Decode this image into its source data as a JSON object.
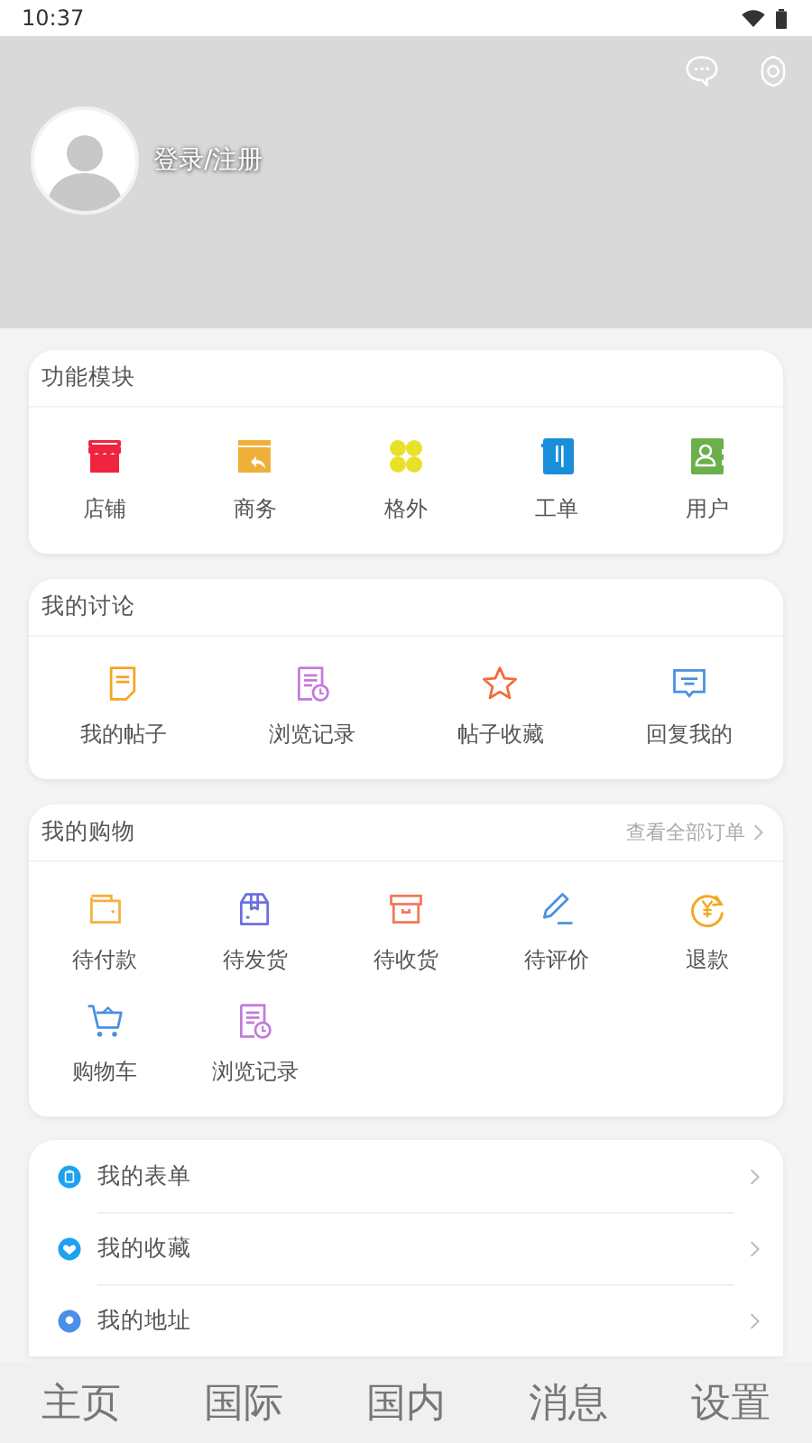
{
  "status_bar": {
    "time": "10:37"
  },
  "profile": {
    "login_label": "登录/注册"
  },
  "modules": {
    "title": "功能模块",
    "items": [
      {
        "label": "店铺"
      },
      {
        "label": "商务"
      },
      {
        "label": "格外"
      },
      {
        "label": "工单"
      },
      {
        "label": "用户"
      }
    ]
  },
  "discussion": {
    "title": "我的讨论",
    "items": [
      {
        "label": "我的帖子"
      },
      {
        "label": "浏览记录"
      },
      {
        "label": "帖子收藏"
      },
      {
        "label": "回复我的"
      }
    ]
  },
  "shopping": {
    "title": "我的购物",
    "link": "查看全部订单",
    "items": [
      {
        "label": "待付款"
      },
      {
        "label": "待发货"
      },
      {
        "label": "待收货"
      },
      {
        "label": "待评价"
      },
      {
        "label": "退款"
      },
      {
        "label": "购物车"
      },
      {
        "label": "浏览记录"
      }
    ]
  },
  "menu": {
    "items": [
      {
        "label": "我的表单"
      },
      {
        "label": "我的收藏"
      },
      {
        "label": "我的地址"
      }
    ]
  },
  "bottom_nav": {
    "tabs": [
      {
        "label": "主页"
      },
      {
        "label": "国际"
      },
      {
        "label": "国内"
      },
      {
        "label": "消息"
      },
      {
        "label": "设置"
      }
    ]
  }
}
